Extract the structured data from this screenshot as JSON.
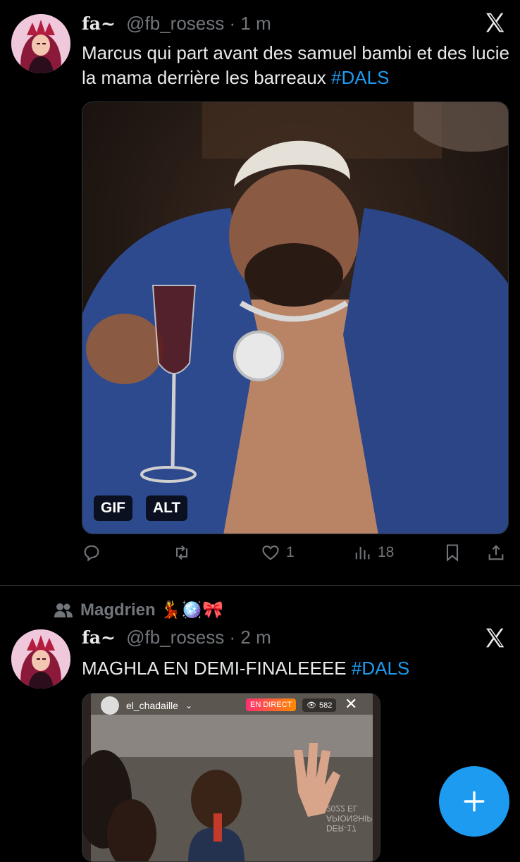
{
  "tweets": [
    {
      "display_name": "fa~",
      "handle": "@fb_rosess",
      "separator": "·",
      "time": "1 m",
      "text": "Marcus qui part avant des samuel bambi et des lucie la mama derrière les barreaux ",
      "hashtag": "#DALS",
      "media": {
        "gif_label": "GIF",
        "alt_label": "ALT"
      },
      "actions": {
        "reply_count": "",
        "retweet_count": "",
        "like_count": "1",
        "views_count": "18"
      }
    },
    {
      "reposted_by": "Magdrien 💃🪩🎀",
      "display_name": "fa~",
      "handle": "@fb_rosess",
      "separator": "·",
      "time": "2 m",
      "text": "MAGHLA EN DEMI-FINALEEEE ",
      "hashtag": "#DALS",
      "media": {
        "live_username": "el_chadaille",
        "live_label": "EN DIRECT",
        "viewer_count": "582",
        "wall_text": "DER-17 APIONSHIP 2022 EL"
      }
    }
  ],
  "colors": {
    "accent": "#1d9bf0",
    "background": "#000000",
    "muted": "#71767b",
    "divider": "#2f3336"
  },
  "icons": [
    "x-logo-icon",
    "reply-icon",
    "retweet-icon",
    "heart-icon",
    "views-icon",
    "bookmark-icon",
    "share-icon",
    "repost-people-icon",
    "eye-icon",
    "close-icon",
    "plus-icon"
  ]
}
